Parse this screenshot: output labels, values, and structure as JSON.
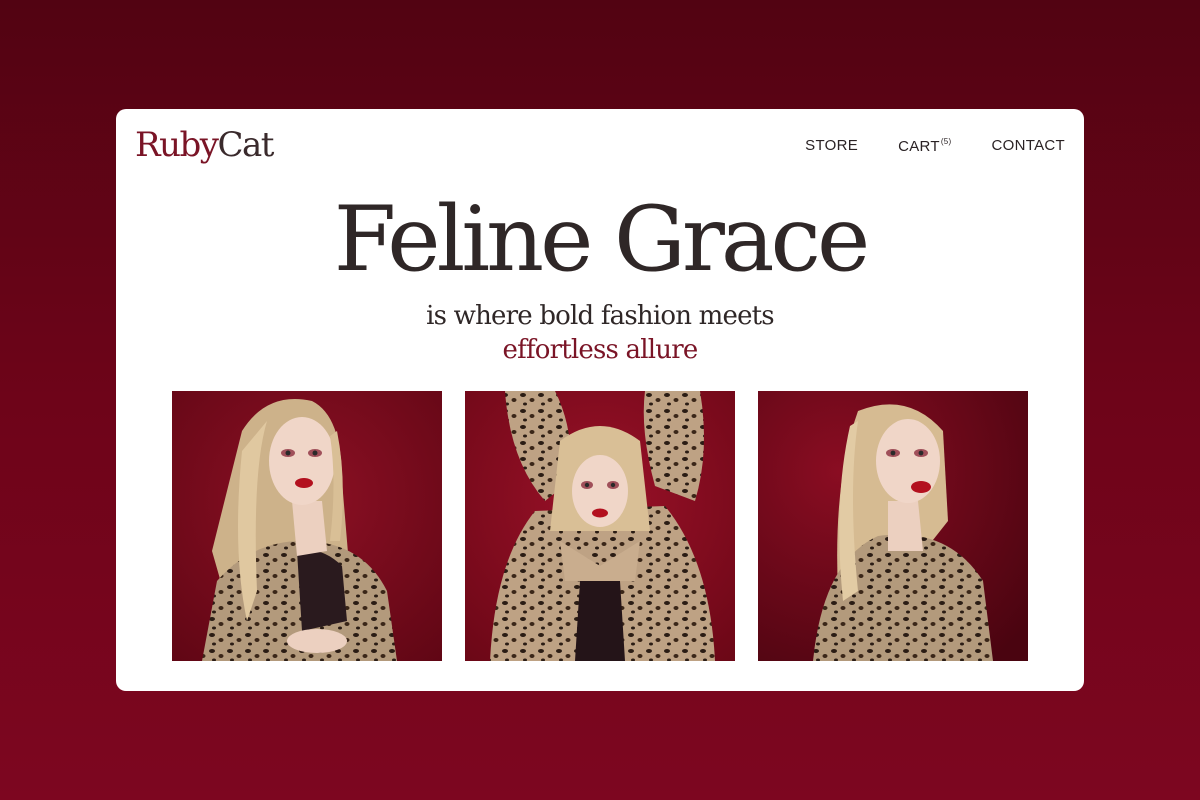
{
  "brand": {
    "logo_part1": "Ruby",
    "logo_part2": "Cat"
  },
  "nav": {
    "store": "STORE",
    "cart": "CART",
    "cart_count": "(5)",
    "contact": "CONTACT"
  },
  "hero": {
    "title": "Feline Grace",
    "subtitle": "is where bold fashion meets",
    "accent": "effortless allure"
  },
  "gallery": {
    "photos": [
      {
        "icon": "model-photo-1"
      },
      {
        "icon": "model-photo-2"
      },
      {
        "icon": "model-photo-3"
      }
    ]
  },
  "colors": {
    "background": "#6e0419",
    "brand_accent": "#7a1426",
    "text_dark": "#2f2727",
    "photo_backdrop": "#7d0a1c",
    "leopard_base": "#b39a7c",
    "hair": "#d9bf96",
    "skin": "#f0d6c8",
    "lips": "#b3101e"
  }
}
